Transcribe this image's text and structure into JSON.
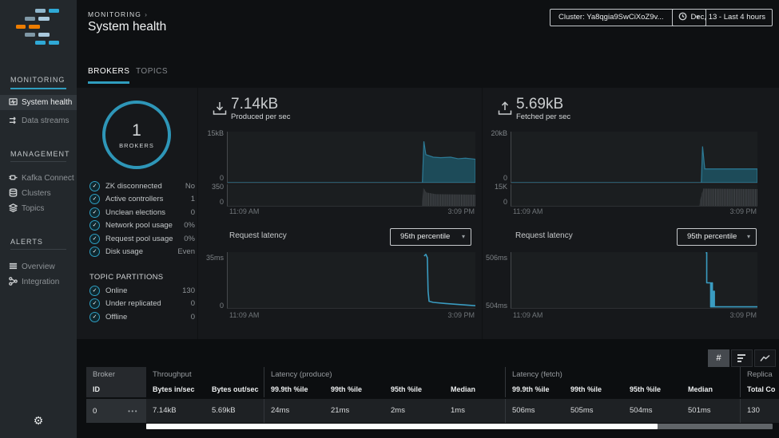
{
  "colors": {
    "accent": "#2f9dbe",
    "chart_area": "#1d4b59",
    "chart_area_edge": "#2d7a95",
    "chart_line": "#3a9cc1",
    "chart_bars": "#43474b"
  },
  "icons": {
    "check": "✓",
    "caret": "▾",
    "gear": "⚙",
    "breadcrumb_sep": "›"
  },
  "sidebar": {
    "sections": [
      {
        "label": "MONITORING",
        "items": [
          {
            "label": "System health",
            "active": true
          },
          {
            "label": "Data streams"
          }
        ]
      },
      {
        "label": "MANAGEMENT",
        "items": [
          {
            "label": "Kafka Connect"
          },
          {
            "label": "Clusters"
          },
          {
            "label": "Topics"
          }
        ]
      },
      {
        "label": "ALERTS",
        "items": [
          {
            "label": "Overview"
          },
          {
            "label": "Integration"
          }
        ]
      }
    ]
  },
  "header": {
    "breadcrumb": "MONITORING",
    "title": "System health",
    "cluster_label": "Cluster: Ya8qgia9SwCiXoZ9v...",
    "time_label": "Dec, 13 - Last 4 hours"
  },
  "tabs": {
    "brokers": "BROKERS",
    "topics": "TOPICS"
  },
  "summary": {
    "count": "1",
    "count_label": "BROKERS",
    "checks": [
      {
        "label": "ZK disconnected",
        "value": "No"
      },
      {
        "label": "Active controllers",
        "value": "1"
      },
      {
        "label": "Unclean elections",
        "value": "0"
      },
      {
        "label": "Network pool usage",
        "value": "0%"
      },
      {
        "label": "Request pool usage",
        "value": "0%"
      },
      {
        "label": "Disk usage",
        "value": "Even"
      }
    ],
    "partitions_title": "TOPIC PARTITIONS",
    "partitions": [
      {
        "label": "Online",
        "value": "130"
      },
      {
        "label": "Under replicated",
        "value": "0"
      },
      {
        "label": "Offline",
        "value": "0"
      }
    ]
  },
  "produced": {
    "value": "7.14kB",
    "caption": "Produced per sec",
    "y_max": "15kB",
    "y_zero": "0",
    "mini_max": "350",
    "mini_zero": "0",
    "x_start": "11:09 AM",
    "x_end": "3:09 PM",
    "latency_title": "Request latency",
    "percentile": "95th percentile",
    "lat_max": "35ms",
    "lat_min": "0"
  },
  "fetched": {
    "value": "5.69kB",
    "caption": "Fetched per sec",
    "y_max": "20kB",
    "y_zero": "0",
    "mini_max": "15K",
    "mini_zero": "0",
    "x_start": "11:09 AM",
    "x_end": "3:09 PM",
    "latency_title": "Request latency",
    "percentile": "95th percentile",
    "lat_max": "506ms",
    "lat_min": "504ms"
  },
  "view_toggle": {
    "hash": "#"
  },
  "table": {
    "group_broker": "Broker",
    "group_throughput": "Throughput",
    "group_latency_produce": "Latency (produce)",
    "group_latency_fetch": "Latency (fetch)",
    "group_replica": "Replica",
    "sub_id": "ID",
    "cols": [
      "Bytes in/sec",
      "Bytes out/sec",
      "99.9th %ile",
      "99th %ile",
      "95th %ile",
      "Median",
      "99.9th %ile",
      "99th %ile",
      "95th %ile",
      "Median",
      "Total Co"
    ],
    "row": {
      "id": "0",
      "menu": "•••",
      "values": [
        "7.14kB",
        "5.69kB",
        "24ms",
        "21ms",
        "2ms",
        "1ms",
        "506ms",
        "505ms",
        "504ms",
        "501ms",
        "130"
      ]
    }
  },
  "chart_data": [
    {
      "id": "produced",
      "type": "area",
      "title": "Produced per sec",
      "current": "7.14kB",
      "ylim": [
        "0",
        "15kB"
      ],
      "x_range": [
        "11:09 AM",
        "3:09 PM"
      ],
      "points": [
        [
          0,
          0
        ],
        [
          0.786,
          0
        ],
        [
          0.792,
          0.81
        ],
        [
          0.8,
          0.55
        ],
        [
          0.83,
          0.5
        ],
        [
          0.86,
          0.49
        ],
        [
          0.9,
          0.5
        ],
        [
          0.93,
          0.47
        ],
        [
          0.96,
          0.48
        ],
        [
          1,
          0.46
        ]
      ],
      "mini": {
        "ylim": [
          "0",
          "350"
        ],
        "points": [
          [
            0,
            0
          ],
          [
            0.784,
            0
          ],
          [
            0.79,
            0.85
          ],
          [
            0.802,
            0.62
          ],
          [
            0.84,
            0.54
          ],
          [
            1,
            0.52
          ]
        ]
      }
    },
    {
      "id": "fetched",
      "type": "area",
      "title": "Fetched per sec",
      "current": "5.69kB",
      "ylim": [
        "0",
        "20kB"
      ],
      "x_range": [
        "11:09 AM",
        "3:09 PM"
      ],
      "points": [
        [
          0,
          0
        ],
        [
          0.772,
          0
        ],
        [
          0.777,
          0.71
        ],
        [
          0.786,
          0.27
        ],
        [
          1,
          0.27
        ]
      ],
      "mini": {
        "ylim": [
          "0",
          "15K"
        ],
        "points": [
          [
            0,
            0
          ],
          [
            0.764,
            0
          ],
          [
            0.77,
            0.4
          ],
          [
            0.78,
            0.8
          ],
          [
            1,
            0.78
          ]
        ]
      }
    },
    {
      "id": "latency-produce",
      "type": "line",
      "title": "Request latency",
      "percentile": "95th percentile",
      "ylim": [
        "0",
        "35ms"
      ],
      "x_range": [
        "11:09 AM",
        "3:09 PM"
      ],
      "points": [
        [
          0.793,
          0.93
        ],
        [
          0.8,
          0.96
        ],
        [
          0.806,
          0.9
        ],
        [
          0.809,
          0.3
        ],
        [
          0.813,
          0.12
        ],
        [
          0.83,
          0.1
        ],
        [
          0.88,
          0.08
        ],
        [
          0.94,
          0.06
        ],
        [
          1,
          0.04
        ]
      ]
    },
    {
      "id": "latency-fetch",
      "type": "line",
      "title": "Request latency",
      "percentile": "95th percentile",
      "ylim": [
        "504ms",
        "506ms"
      ],
      "x_range": [
        "11:09 AM",
        "3:09 PM"
      ],
      "points": [
        [
          0.79,
          0.99
        ],
        [
          0.794,
          0.99
        ],
        [
          0.794,
          0.45
        ],
        [
          0.81,
          0.45
        ],
        [
          0.81,
          0.02
        ],
        [
          0.814,
          0.02
        ],
        [
          0.814,
          0.45
        ],
        [
          0.817,
          0.45
        ],
        [
          0.817,
          0.02
        ],
        [
          0.822,
          0.02
        ],
        [
          0.822,
          0.3
        ],
        [
          0.825,
          0.3
        ],
        [
          0.825,
          0.02
        ],
        [
          1,
          0.02
        ]
      ]
    }
  ]
}
